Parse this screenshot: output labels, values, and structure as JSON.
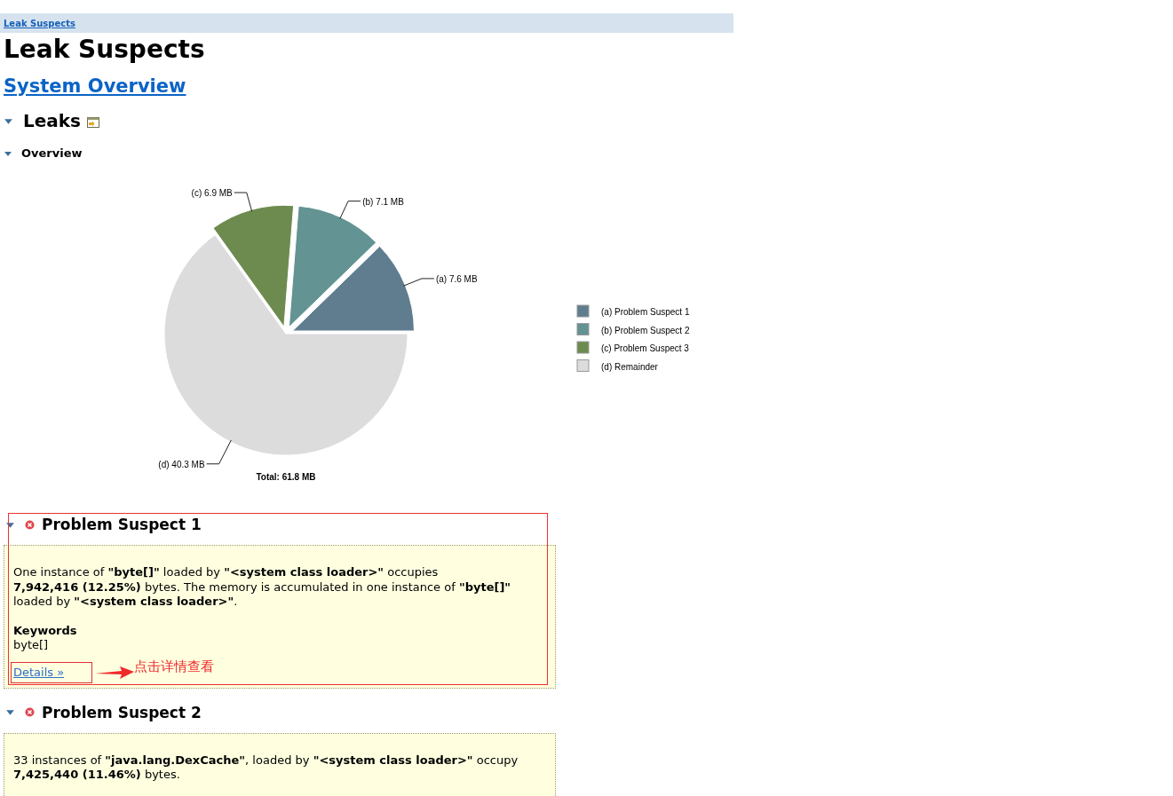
{
  "breadcrumb": {
    "label": "Leak Suspects"
  },
  "title": "Leak Suspects",
  "overview_link": "System Overview",
  "leaks": {
    "title": "Leaks",
    "expanded": true,
    "overview": {
      "title": "Overview",
      "expanded": true,
      "chart_data": {
        "type": "pie",
        "title": "Total: 61.8 MB",
        "categories": [
          "(a)  Problem Suspect 1",
          "(b)  Problem Suspect 2",
          "(c)  Problem Suspect 3",
          "(d)  Remainder"
        ],
        "values": [
          7.6,
          7.1,
          6.9,
          40.3
        ],
        "legend": "right",
        "colors": [
          "#5f7d8f",
          "#639393",
          "#6d8b4f",
          "#dcdcdc"
        ],
        "value_labels": [
          "(a)  7.6 MB",
          "(b)  7.1 MB",
          "(c)  6.9 MB",
          "(d)  40.3 MB"
        ]
      }
    }
  },
  "suspects": [
    {
      "title": "Problem Suspect 1",
      "expanded": true,
      "description": "One instance of **\"byte[]\"** loaded by **\"<system class loader>\"** occupies **7,942,416 (12.25%)** bytes. The memory is accumulated in one instance of **\"byte[]\"** loaded by **\"<system class loader>\"**.",
      "keywords_label": "Keywords",
      "keywords": "byte[]",
      "details_link": "Details »",
      "annotation": "点击详情查看"
    },
    {
      "title": "Problem Suspect 2",
      "expanded": true,
      "description": "33 instances of **\"java.lang.DexCache\"**, loaded by **\"<system class loader>\"** occupy **7,425,440 (11.46%)** bytes."
    }
  ]
}
